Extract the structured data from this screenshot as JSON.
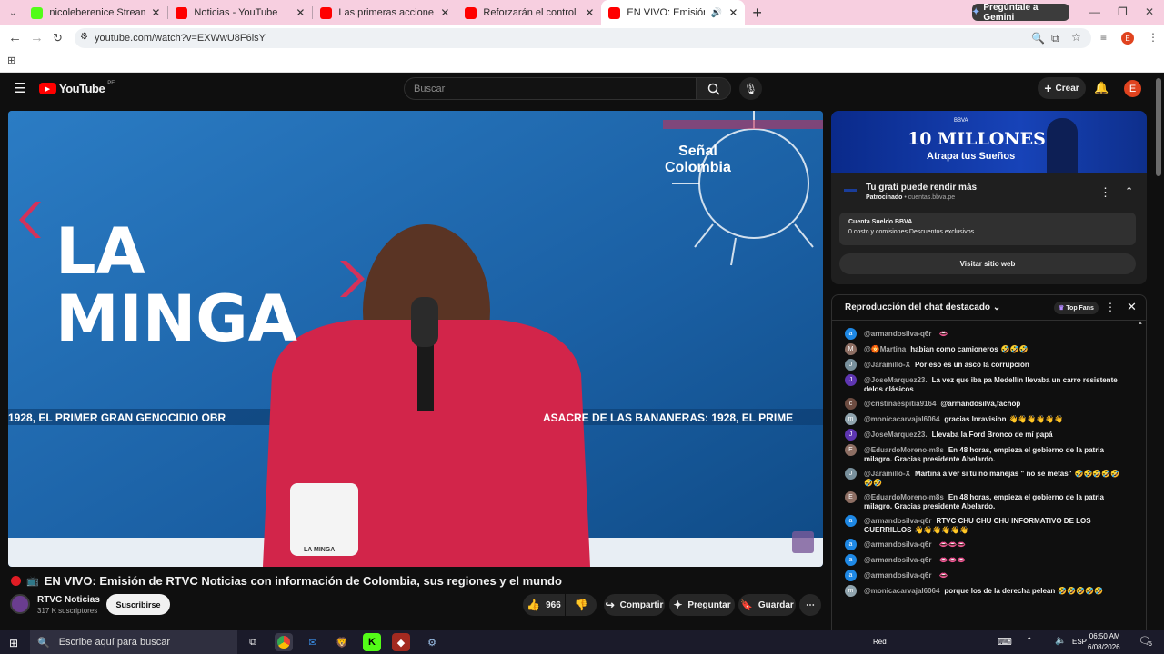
{
  "browser": {
    "tabs": [
      {
        "label": "nicoleberenice Stream - Watch",
        "favicon_color": "#53fc18",
        "active": false
      },
      {
        "label": "Noticias - YouTube",
        "favicon_color": "#ff0000",
        "active": false
      },
      {
        "label": "Las primeras acciones de Keiko",
        "favicon_color": "#ff0000",
        "active": false
      },
      {
        "label": "Reforzarán el control en las fron",
        "favicon_color": "#ff0000",
        "active": false
      },
      {
        "label": "EN VIVO: Emisión de",
        "favicon_color": "#ff0000",
        "active": true
      }
    ],
    "new_tab": "+",
    "gemini_label": "Pregúntale a Gemini",
    "url": "youtube.com/watch?v=EXWwU8F6lsY",
    "profile_letter": "E"
  },
  "youtube": {
    "logo": "YouTube",
    "region": "PE",
    "search_placeholder": "Buscar",
    "create_label": "Crear",
    "avatar_letter": "E"
  },
  "video": {
    "overlay_la": "LA",
    "overlay_minga": "MINGA",
    "channel_logo_line1": "Señal",
    "channel_logo_line2": "Colombia",
    "ticker": "1928, EL PRIMER GRAN GENOCIDIO OBR",
    "ticker_right": "ASACRE DE LAS BANANERAS: 1928, EL PRIME",
    "mug_text": "LA MINGA",
    "title": "EN VIVO: Emisión de RTVC Noticias con información de Colombia, sus regiones y el mundo",
    "channel_name": "RTVC Noticias",
    "subscribers": "317 K suscriptores",
    "subscribe_label": "Suscribirse",
    "likes": "966",
    "share_label": "Compartir",
    "ask_label": "Preguntar",
    "save_label": "Guardar"
  },
  "ad": {
    "banner_top": "BBVA",
    "banner_big": "10 MILLONES",
    "banner_sub": "Atrapa tus Sueños",
    "headline": "Tu grati puede rendir más",
    "sponsored": "Patrocinado",
    "domain": "cuentas.bbva.pe",
    "product_title": "Cuenta Sueldo BBVA",
    "product_desc": "0 costo y comisiones Descuentos exclusivos",
    "cta": "Visitar sitio web"
  },
  "chat": {
    "header": "Reproducción del chat destacado",
    "filter_badge": "Top Fans",
    "messages": [
      {
        "author": "@armandosilva-q6r",
        "text": "",
        "emoji": "👄",
        "avatar_color": "#1e88e5",
        "avatar_letter": "a"
      },
      {
        "author": "@🏵️Martina",
        "text": "habian como camioneros",
        "emoji": "🤣🤣🤣",
        "avatar_color": "#8d6e63",
        "avatar_letter": "M"
      },
      {
        "author": "@Jaramillo-X",
        "text": "Por eso es un asco la corrupción",
        "emoji": "",
        "avatar_color": "#78909c",
        "avatar_letter": "J"
      },
      {
        "author": "@JoseMarquez23.",
        "text": "La vez que iba pa Medellín llevaba un carro resistente delos clásicos",
        "emoji": "",
        "avatar_color": "#5e35b1",
        "avatar_letter": "J"
      },
      {
        "author": "@cristinaespitia9164",
        "text": "@armandosilva,fachop",
        "emoji": "",
        "avatar_color": "#6d4c41",
        "avatar_letter": "c"
      },
      {
        "author": "@monicacarvajal6064",
        "text": "gracias lnravision",
        "emoji": "👋👋👋👋👋👋",
        "avatar_color": "#90a4ae",
        "avatar_letter": "m"
      },
      {
        "author": "@JoseMarquez23.",
        "text": "Llevaba la Ford Bronco de mí papá",
        "emoji": "",
        "avatar_color": "#5e35b1",
        "avatar_letter": "J"
      },
      {
        "author": "@EduardoMoreno-m8s",
        "text": "En 48 horas, empieza el gobierno de la patria milagro. Gracias presidente Abelardo.",
        "emoji": "",
        "avatar_color": "#8d6e63",
        "avatar_letter": "E"
      },
      {
        "author": "@Jaramillo-X",
        "text": "Martina a ver si tú no manejas \" no se metas\"",
        "emoji": "🤣🤣🤣🤣🤣🤣🤣",
        "avatar_color": "#78909c",
        "avatar_letter": "J"
      },
      {
        "author": "@EduardoMoreno-m8s",
        "text": "En 48 horas, empieza el gobierno de la patria milagro. Gracias presidente Abelardo.",
        "emoji": "",
        "avatar_color": "#8d6e63",
        "avatar_letter": "E"
      },
      {
        "author": "@armandosilva-q6r",
        "text": "RTVC CHU CHU CHU INFORMATIVO DE LOS GUERRILLOS",
        "emoji": "👋👋👋👋👋👋",
        "avatar_color": "#1e88e5",
        "avatar_letter": "a"
      },
      {
        "author": "@armandosilva-q6r",
        "text": "",
        "emoji": "👄👄👄",
        "avatar_color": "#1e88e5",
        "avatar_letter": "a"
      },
      {
        "author": "@armandosilva-q6r",
        "text": "",
        "emoji": "👄👄👄",
        "avatar_color": "#1e88e5",
        "avatar_letter": "a"
      },
      {
        "author": "@armandosilva-q6r",
        "text": "",
        "emoji": "👄",
        "avatar_color": "#1e88e5",
        "avatar_letter": "a"
      },
      {
        "author": "@monicacarvajal6064",
        "text": "porque los de la derecha pelean",
        "emoji": "🤣🤣🤣🤣🤣",
        "avatar_color": "#90a4ae",
        "avatar_letter": "m"
      }
    ]
  },
  "taskbar": {
    "search_placeholder": "Escribe aquí para buscar",
    "network": "Red",
    "language": "ESP",
    "time": "06:50 AM",
    "date": "6/08/2026",
    "notif_count": "5"
  }
}
